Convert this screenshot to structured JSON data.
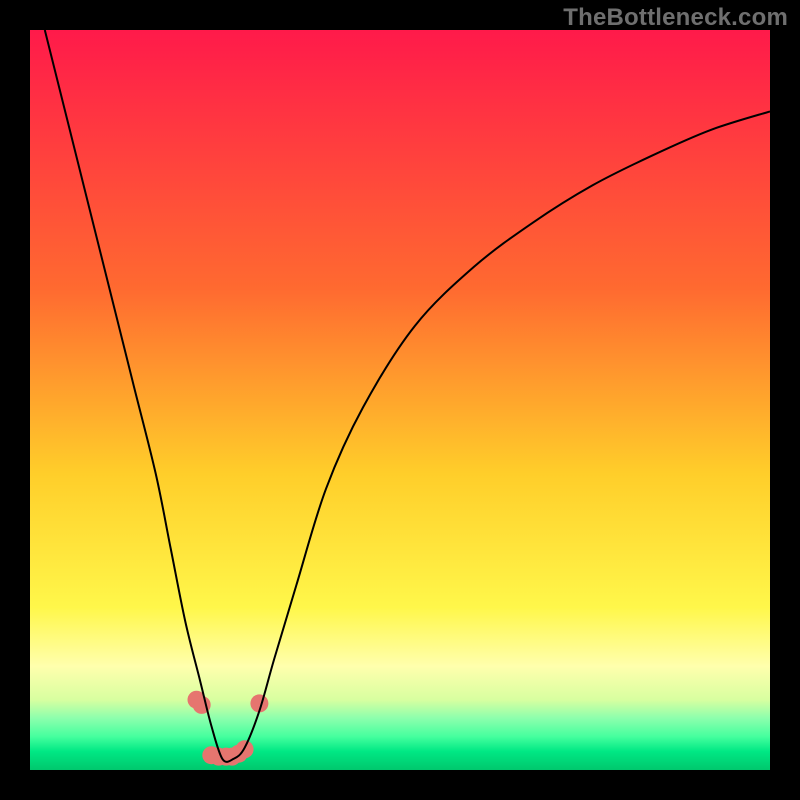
{
  "watermark": "TheBottleneck.com",
  "chart_data": {
    "type": "line",
    "title": "",
    "xlabel": "",
    "ylabel": "",
    "xlim": [
      0,
      100
    ],
    "ylim": [
      0,
      100
    ],
    "grid": false,
    "background_gradient": [
      {
        "stop": 0.0,
        "color": "#ff1a4a"
      },
      {
        "stop": 0.35,
        "color": "#ff6a30"
      },
      {
        "stop": 0.6,
        "color": "#ffce2a"
      },
      {
        "stop": 0.78,
        "color": "#fff74a"
      },
      {
        "stop": 0.86,
        "color": "#ffffad"
      },
      {
        "stop": 0.905,
        "color": "#d8ffa0"
      },
      {
        "stop": 0.93,
        "color": "#8cffad"
      },
      {
        "stop": 0.955,
        "color": "#45ff9e"
      },
      {
        "stop": 0.975,
        "color": "#00e884"
      },
      {
        "stop": 1.0,
        "color": "#00c76d"
      }
    ],
    "series": [
      {
        "name": "bottleneck-curve",
        "x": [
          2,
          5,
          8,
          11,
          14,
          17,
          19,
          21,
          23,
          24.5,
          26,
          27.5,
          29,
          31,
          33,
          36,
          40,
          45,
          52,
          60,
          68,
          76,
          84,
          92,
          100
        ],
        "y": [
          100,
          88,
          76,
          64,
          52,
          40,
          30,
          20,
          12,
          6,
          1.5,
          1.5,
          3,
          8,
          15,
          25,
          38,
          49,
          60,
          68,
          74,
          79,
          83,
          86.5,
          89
        ]
      }
    ],
    "markers": [
      {
        "x": 22.5,
        "y": 9.5
      },
      {
        "x": 23.2,
        "y": 8.8
      },
      {
        "x": 24.5,
        "y": 2.0
      },
      {
        "x": 25.5,
        "y": 1.8
      },
      {
        "x": 26.5,
        "y": 1.8
      },
      {
        "x": 27.3,
        "y": 1.8
      },
      {
        "x": 28.2,
        "y": 2.2
      },
      {
        "x": 29.0,
        "y": 2.8
      },
      {
        "x": 31.0,
        "y": 9.0
      }
    ],
    "marker_style": {
      "color": "#e6756f",
      "radius": 9
    }
  }
}
